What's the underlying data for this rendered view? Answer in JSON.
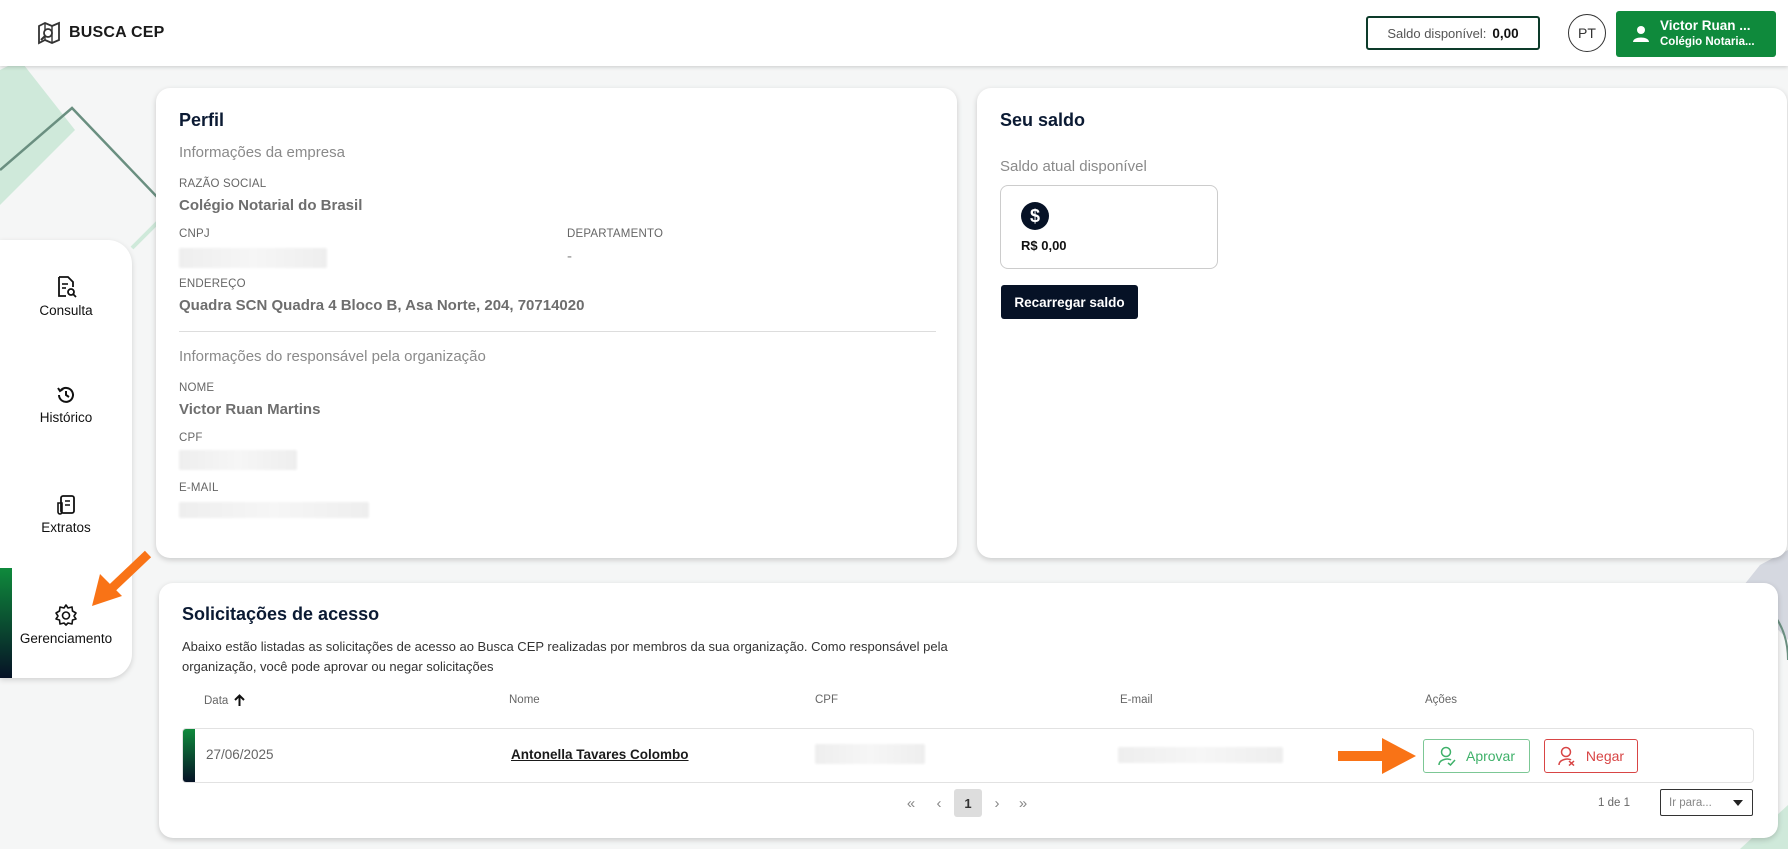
{
  "header": {
    "logo_text": "BUSCA CEP",
    "saldo_label": "Saldo disponível:",
    "saldo_value": "0,00",
    "language": "PT",
    "user_name": "Victor Ruan ...",
    "user_org": "Colégio Notaria..."
  },
  "sidebar": {
    "items": [
      {
        "label": "Consulta",
        "icon": "document-search-icon"
      },
      {
        "label": "Histórico",
        "icon": "history-icon"
      },
      {
        "label": "Extratos",
        "icon": "receipt-icon"
      },
      {
        "label": "Gerenciamento",
        "icon": "gear-icon"
      }
    ],
    "active": "Gerenciamento"
  },
  "profile": {
    "title": "Perfil",
    "company_section": "Informações da empresa",
    "razao_label": "RAZÃO SOCIAL",
    "razao_value": "Colégio Notarial do Brasil",
    "cnpj_label": "CNPJ",
    "departamento_label": "DEPARTAMENTO",
    "departamento_value": "-",
    "endereco_label": "ENDEREÇO",
    "endereco_value": "Quadra SCN Quadra 4 Bloco B, Asa Norte, 204, 70714020",
    "responsavel_section": "Informações do responsável pela organização",
    "nome_label": "NOME",
    "nome_value": "Victor Ruan Martins",
    "cpf_label": "CPF",
    "email_label": "E-MAIL"
  },
  "balance": {
    "title": "Seu saldo",
    "subtitle": "Saldo atual disponível",
    "amount": "R$ 0,00",
    "recharge_button": "Recarregar saldo"
  },
  "requests": {
    "title": "Solicitações de acesso",
    "description": "Abaixo estão listadas as solicitações de acesso ao Busca CEP realizadas por membros da sua organização. Como responsável pela organização, você pode aprovar ou negar solicitações",
    "columns": [
      "Data",
      "Nome",
      "CPF",
      "E-mail",
      "Ações"
    ],
    "rows": [
      {
        "date": "27/06/2025",
        "name": "Antonella Tavares Colombo"
      }
    ],
    "approve_label": "Aprovar",
    "deny_label": "Negar",
    "pagination": {
      "current_page": "1",
      "page_info": "1 de 1",
      "goto_placeholder": "Ir para..."
    }
  },
  "colors": {
    "brand_green": "#0f8a3c",
    "dark_navy": "#061226",
    "approve_green": "#3fb16a",
    "deny_red": "#d84545",
    "annotation_orange": "#f97316"
  }
}
